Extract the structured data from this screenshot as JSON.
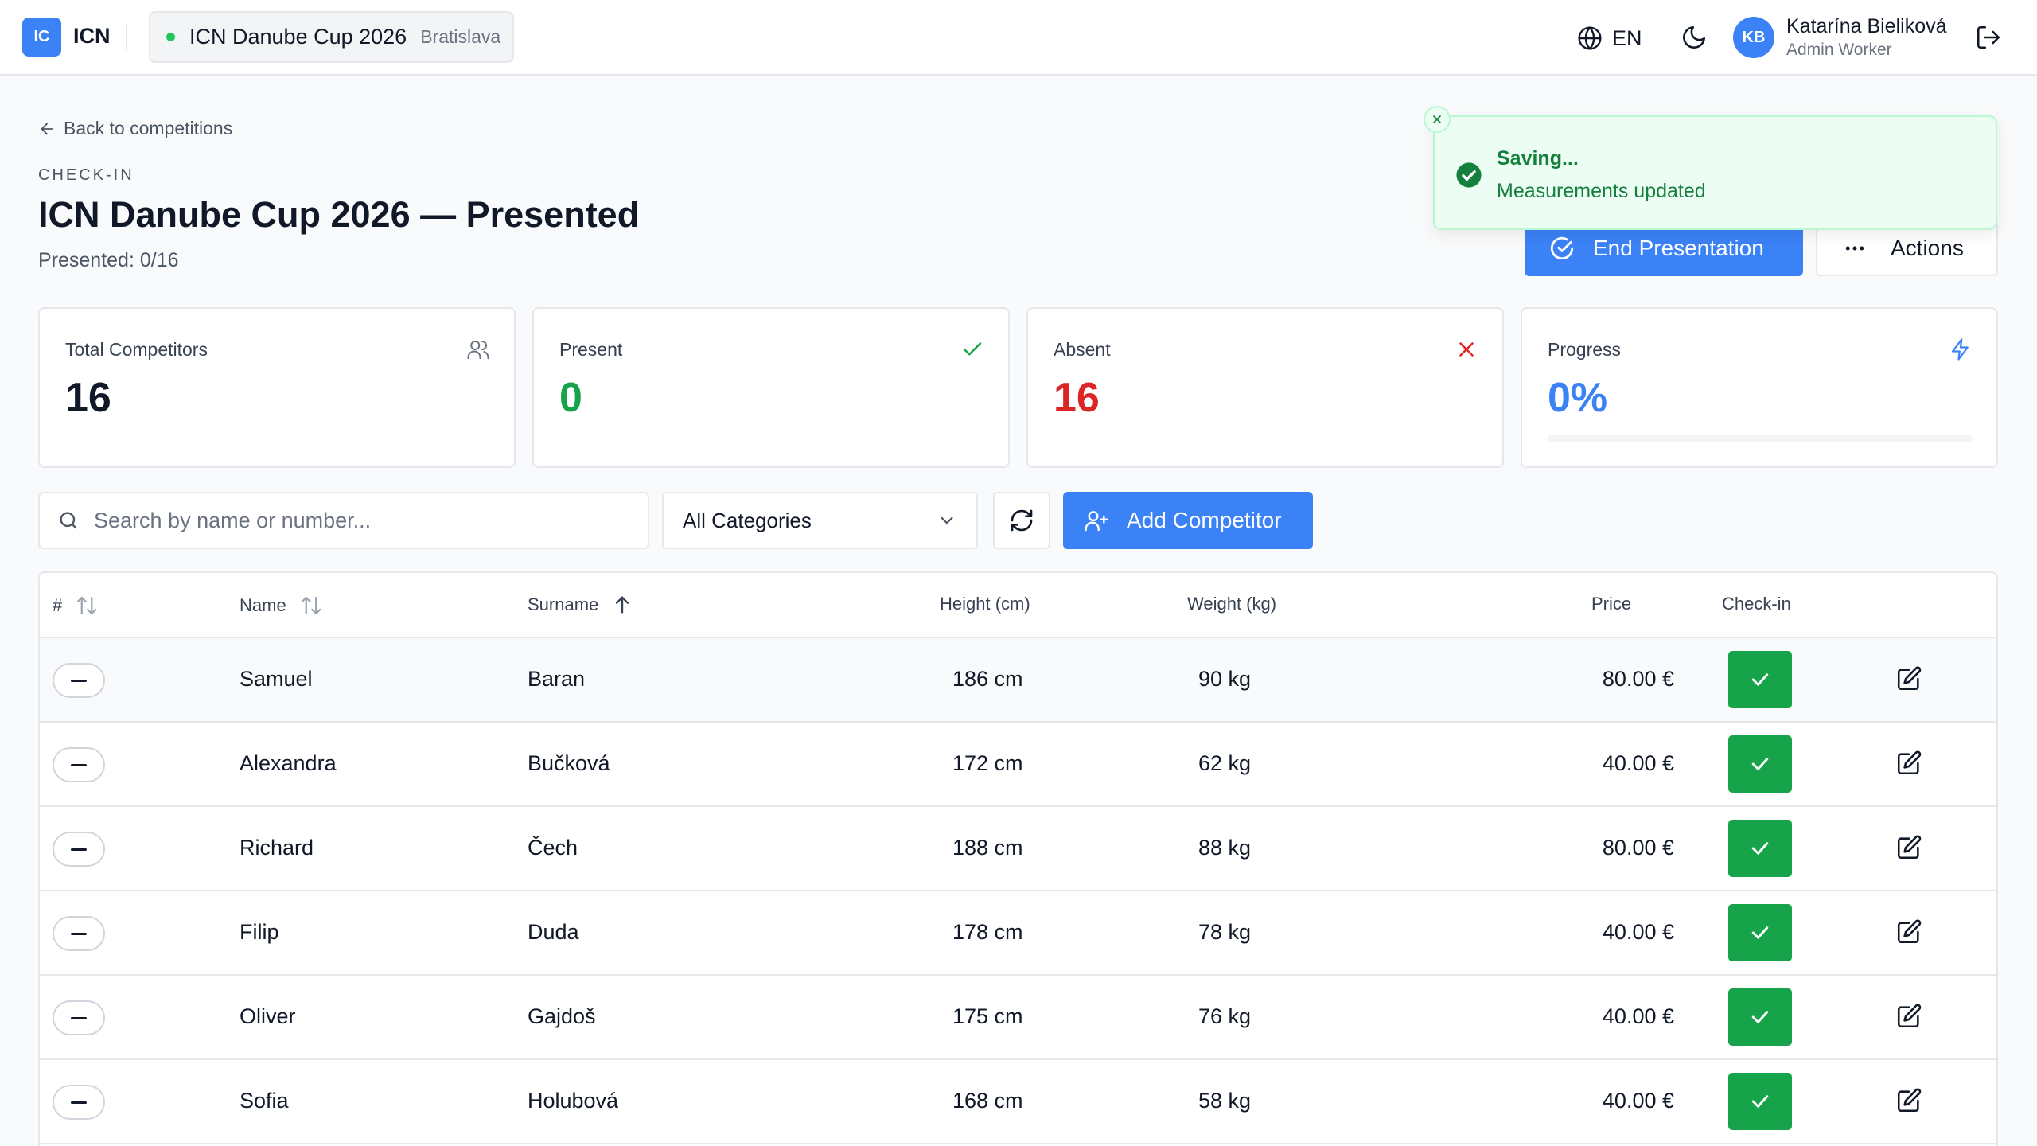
{
  "topbar": {
    "logo_badge": "IC",
    "logo_text": "ICN",
    "competition_name": "ICN Danube Cup 2026",
    "competition_city": "Bratislava",
    "language": "EN",
    "user_initials": "KB",
    "user_name": "Katarína Bieliková",
    "user_role": "Admin Worker"
  },
  "header": {
    "back_label": "Back to competitions",
    "eyebrow": "CHECK-IN",
    "title": "ICN Danube Cup 2026 — Presented",
    "presented_count": "Presented: 0/16",
    "end_button": "End Presentation",
    "actions_button": "Actions"
  },
  "toast": {
    "title": "Saving...",
    "message": "Measurements updated"
  },
  "stats": {
    "total": {
      "label": "Total Competitors",
      "value": "16"
    },
    "present": {
      "label": "Present",
      "value": "0"
    },
    "absent": {
      "label": "Absent",
      "value": "16"
    },
    "progress": {
      "label": "Progress",
      "value": "0%",
      "fraction": 0
    }
  },
  "filters": {
    "search_placeholder": "Search by name or number...",
    "category_selected": "All Categories",
    "add_button": "Add Competitor"
  },
  "table": {
    "headers": {
      "number": "#",
      "name": "Name",
      "surname": "Surname",
      "height": "Height (cm)",
      "weight": "Weight (kg)",
      "price": "Price",
      "checkin": "Check-in"
    },
    "rows": [
      {
        "name": "Samuel",
        "surname": "Baran",
        "height": "186 cm",
        "weight": "90 kg",
        "price": "80.00 €"
      },
      {
        "name": "Alexandra",
        "surname": "Bučková",
        "height": "172 cm",
        "weight": "62 kg",
        "price": "40.00 €"
      },
      {
        "name": "Richard",
        "surname": "Čech",
        "height": "188 cm",
        "weight": "88 kg",
        "price": "80.00 €"
      },
      {
        "name": "Filip",
        "surname": "Duda",
        "height": "178 cm",
        "weight": "78 kg",
        "price": "40.00 €"
      },
      {
        "name": "Oliver",
        "surname": "Gajdoš",
        "height": "175 cm",
        "weight": "76 kg",
        "price": "40.00 €"
      },
      {
        "name": "Sofia",
        "surname": "Holubová",
        "height": "168 cm",
        "weight": "58 kg",
        "price": "40.00 €"
      }
    ]
  },
  "colors": {
    "primary": "#3b82f6",
    "success": "#16a34a",
    "danger": "#dc2626",
    "toast_bg": "#ecfdf3"
  }
}
